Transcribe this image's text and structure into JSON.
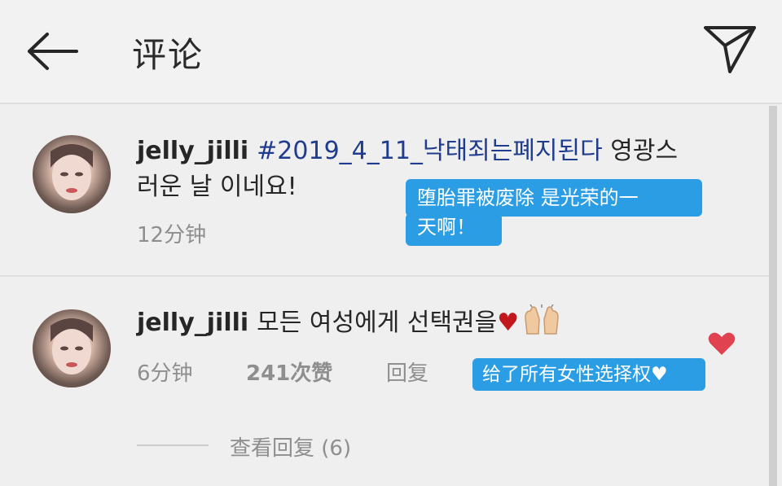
{
  "header": {
    "title": "评论"
  },
  "comments": [
    {
      "username": "jelly_jilli",
      "hashtag": "#2019_4_11_낙태죄는폐지된다",
      "text": " 영광스러운 날 이네요!",
      "time": "12分钟"
    },
    {
      "username": "jelly_jilli",
      "text": "모든 여성에게 선택권을",
      "heart": "♥",
      "time": "6分钟",
      "likes": "241次赞",
      "reply_label": "回复",
      "view_replies": "查看回复 (6)"
    }
  ],
  "subtitles": {
    "line1a": "堕胎罪被废除 是光荣的一",
    "line1b": "天啊！",
    "line2": "给了所有女性选择权♥"
  },
  "colors": {
    "subtitle_bg": "#2a9de5",
    "hashtag": "#1f3c8f",
    "heart": "#c3171e",
    "like_heart": "#e0424f"
  },
  "icons": {
    "back": "arrow-left-icon",
    "send": "paper-plane-icon",
    "like": "heart-icon",
    "clap": "raising-hands-emoji"
  }
}
